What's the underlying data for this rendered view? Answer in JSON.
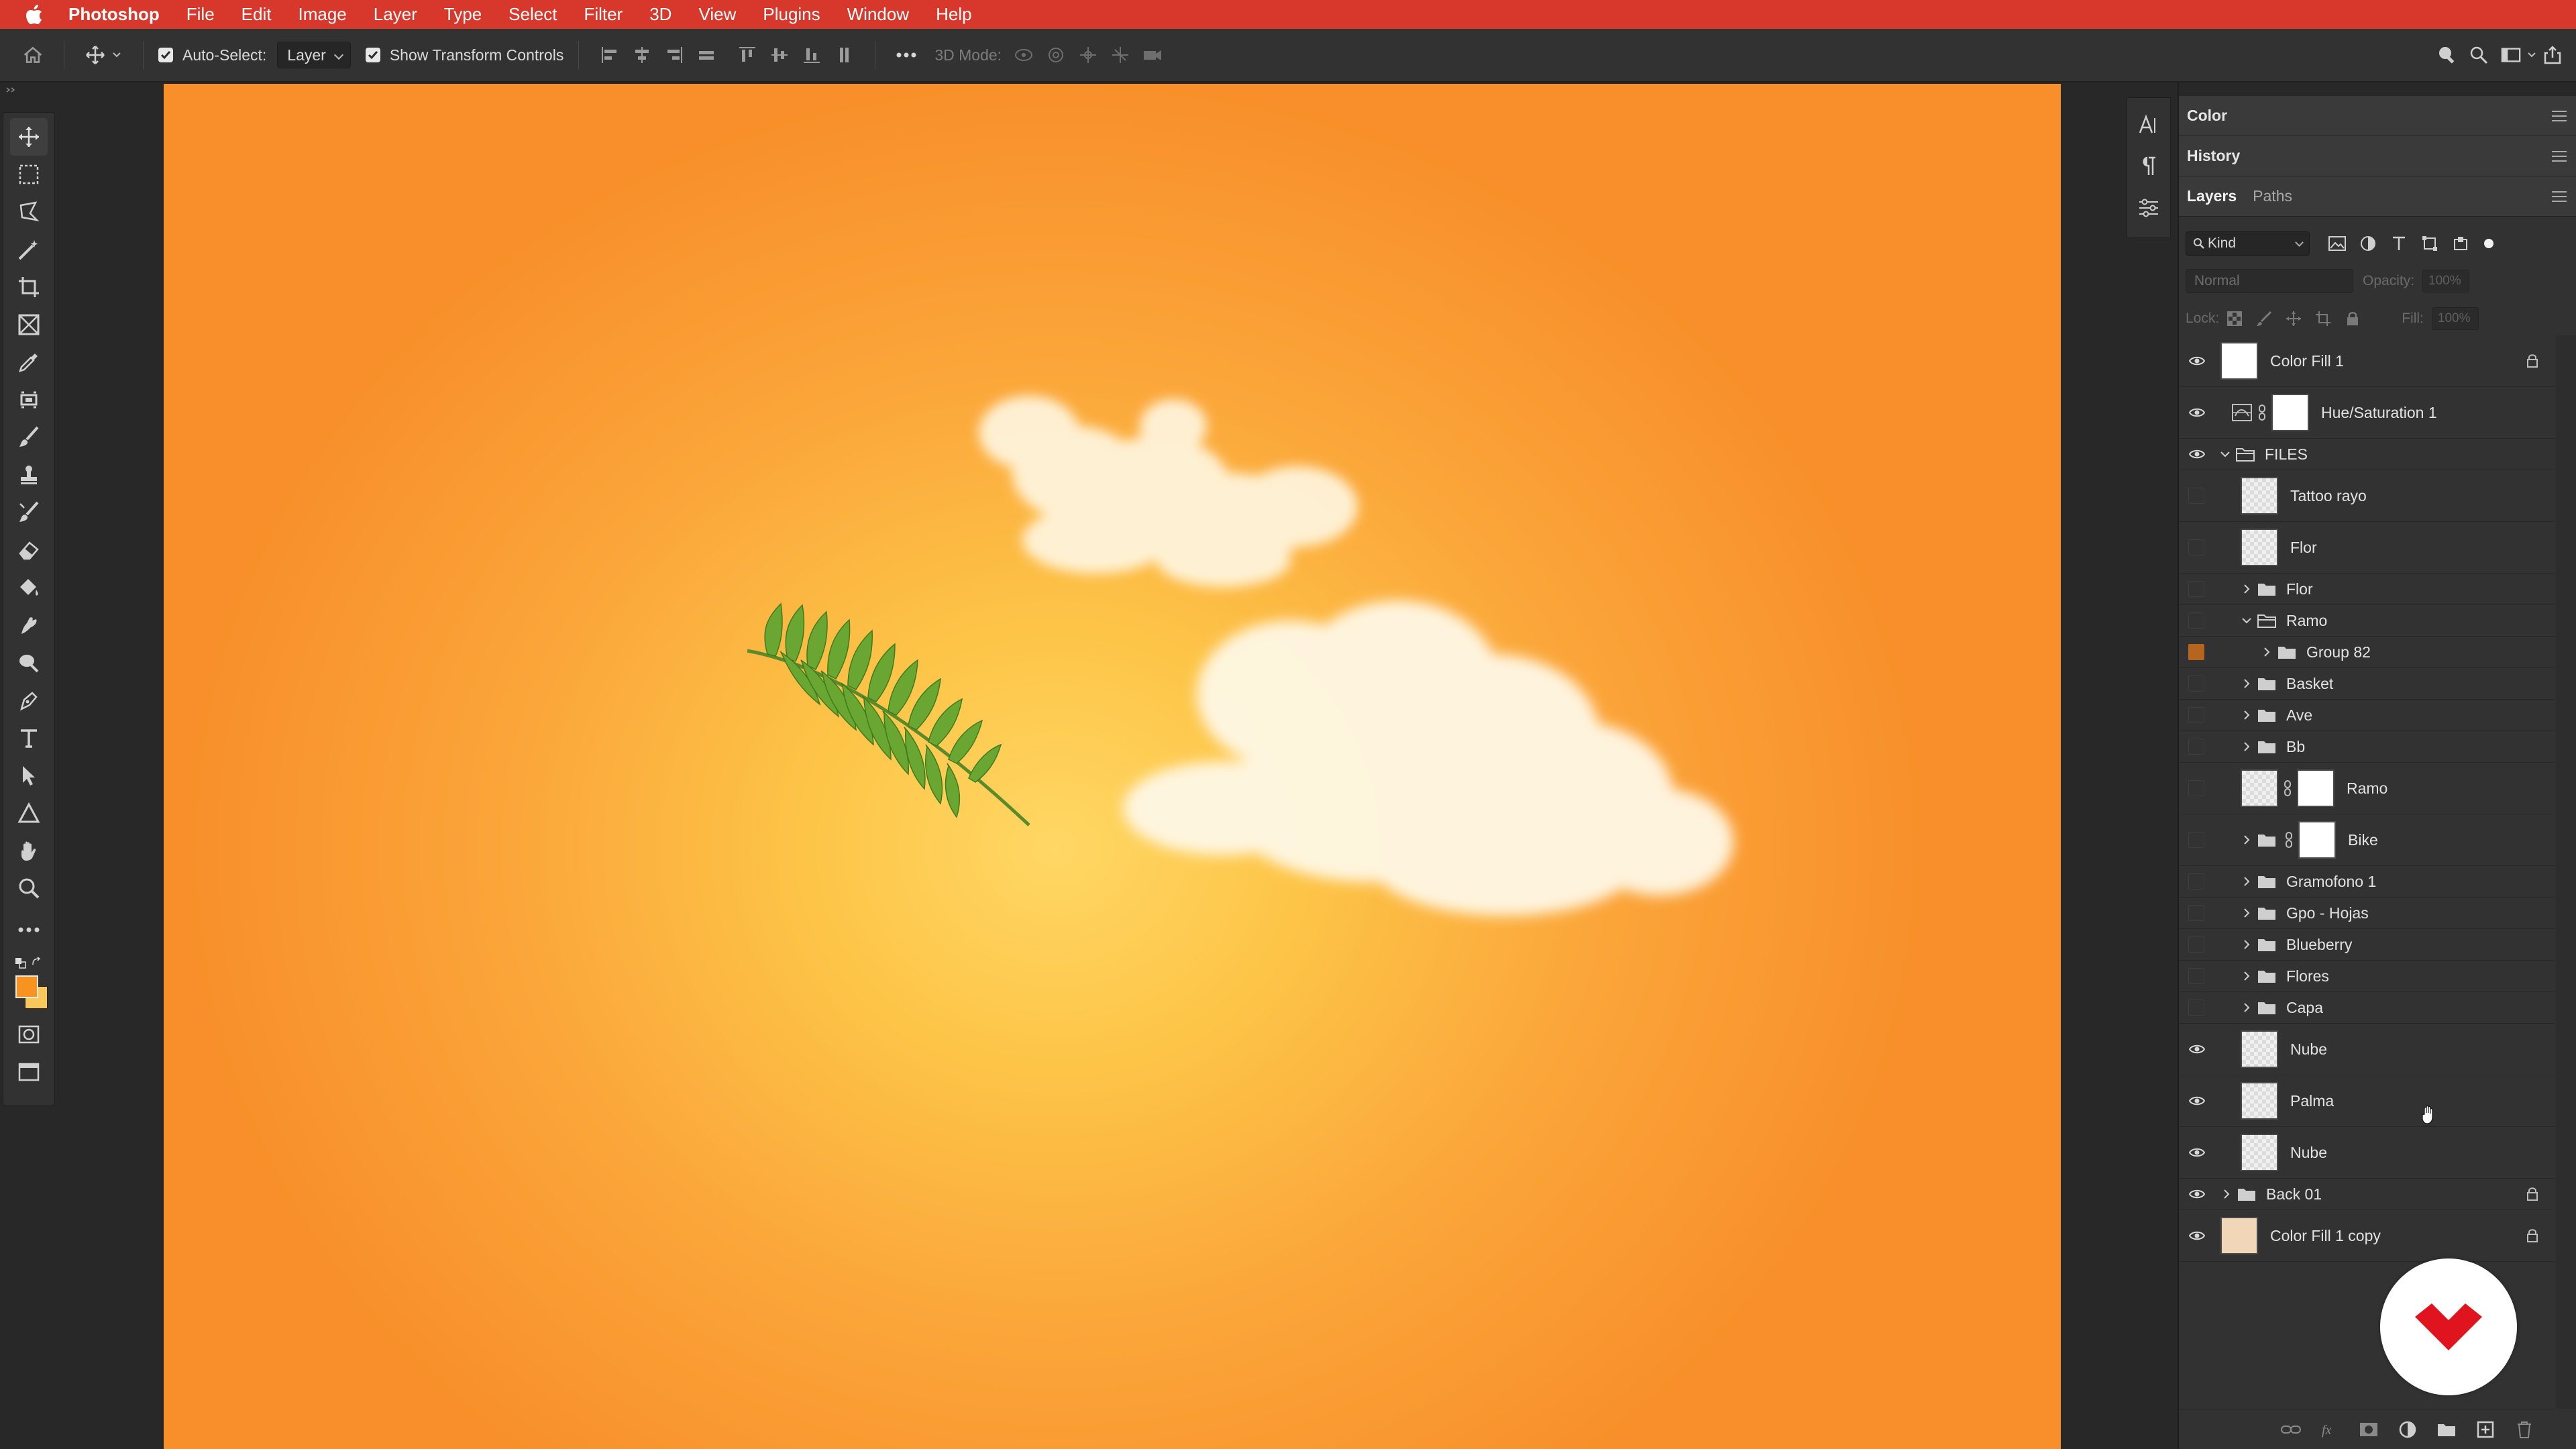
{
  "menubar": {
    "app_name": "Photoshop",
    "menus": [
      "File",
      "Edit",
      "Image",
      "Layer",
      "Type",
      "Select",
      "Filter",
      "3D",
      "View",
      "Plugins",
      "Window",
      "Help"
    ],
    "color": "#d8372b"
  },
  "options_bar": {
    "auto_select_label": "Auto-Select:",
    "auto_select_checked": true,
    "auto_select_target": "Layer",
    "show_transform_label": "Show Transform Controls",
    "show_transform_checked": true,
    "mode_3d_label": "3D Mode:"
  },
  "toolbar": {
    "tools": [
      "move-tool",
      "marquee-tool",
      "lasso-tool",
      "magic-wand-tool",
      "crop-tool",
      "frame-tool",
      "eyedropper-tool",
      "healing-tool",
      "brush-tool",
      "stamp-tool",
      "history-brush-tool",
      "eraser-tool",
      "paint-bucket-tool",
      "smudge-tool",
      "dodge-tool",
      "pen-tool",
      "type-tool",
      "path-select-tool",
      "shape-tool",
      "hand-tool",
      "zoom-tool",
      "more-tools"
    ],
    "active_tool": "move-tool",
    "foreground_color": "#f7931e",
    "background_color": "#f9c75a"
  },
  "panels": {
    "color_title": "Color",
    "history_title": "History",
    "layers_tab": "Layers",
    "paths_tab": "Paths",
    "filter_kind": "Kind",
    "blend_mode": "Normal",
    "opacity_label": "Opacity:",
    "opacity_value": "100%",
    "lock_label": "Lock:",
    "fill_label": "Fill:",
    "fill_value": "100%"
  },
  "layers": [
    {
      "name": "Color Fill 1",
      "visible": true,
      "type": "fill",
      "indent": 0,
      "locked": true
    },
    {
      "name": "Hue/Saturation 1",
      "visible": true,
      "type": "adjustment",
      "indent": 0
    },
    {
      "name": "FILES",
      "visible": true,
      "type": "group-open",
      "indent": 0
    },
    {
      "name": "Tattoo rayo",
      "visible": false,
      "type": "pixel",
      "indent": 1
    },
    {
      "name": "Flor",
      "visible": false,
      "type": "pixel",
      "indent": 1
    },
    {
      "name": "Flor",
      "visible": false,
      "type": "group",
      "indent": 1
    },
    {
      "name": "Ramo",
      "visible": false,
      "type": "group-open",
      "indent": 1
    },
    {
      "name": "Group 82",
      "visible": false,
      "type": "group",
      "indent": 2,
      "highlight": true
    },
    {
      "name": "Basket",
      "visible": false,
      "type": "group",
      "indent": 1
    },
    {
      "name": "Ave",
      "visible": false,
      "type": "group",
      "indent": 1
    },
    {
      "name": "Bb",
      "visible": false,
      "type": "group",
      "indent": 1
    },
    {
      "name": "Ramo",
      "visible": false,
      "type": "masked",
      "indent": 1
    },
    {
      "name": "Bike",
      "visible": false,
      "type": "group-masked",
      "indent": 1
    },
    {
      "name": "Gramofono 1",
      "visible": false,
      "type": "group",
      "indent": 1
    },
    {
      "name": "Gpo - Hojas",
      "visible": false,
      "type": "group",
      "indent": 1
    },
    {
      "name": "Blueberry",
      "visible": false,
      "type": "group",
      "indent": 1
    },
    {
      "name": "Flores",
      "visible": false,
      "type": "group",
      "indent": 1
    },
    {
      "name": "Capa",
      "visible": false,
      "type": "group",
      "indent": 1
    },
    {
      "name": "Nube",
      "visible": true,
      "type": "pixel",
      "indent": 1
    },
    {
      "name": "Palma",
      "visible": true,
      "type": "pixel",
      "indent": 1
    },
    {
      "name": "Nube",
      "visible": true,
      "type": "pixel",
      "indent": 1
    },
    {
      "name": "Back 01",
      "visible": true,
      "type": "group",
      "indent": 0,
      "locked": true
    },
    {
      "name": "Color Fill 1 copy",
      "visible": true,
      "type": "fill-tan",
      "indent": 0,
      "locked": true
    }
  ],
  "colors": {
    "canvas_center": "#ffd764",
    "canvas_edge": "#f88f2a",
    "ui_panel": "#323232",
    "badge_red": "#e0141e"
  }
}
